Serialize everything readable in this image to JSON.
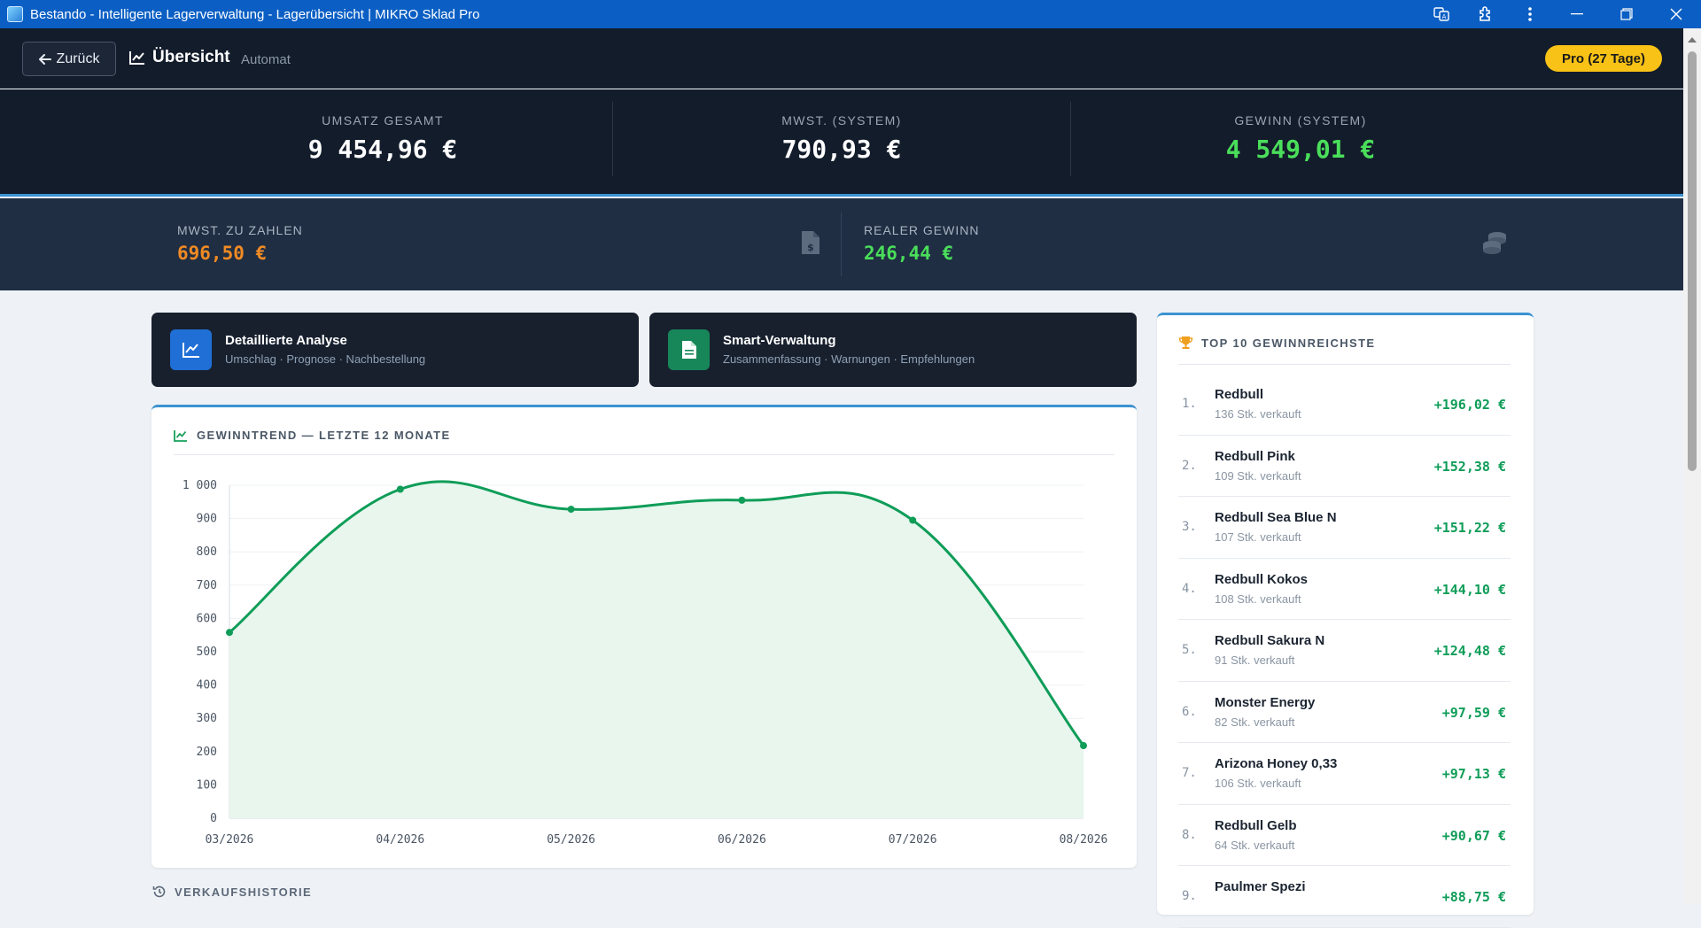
{
  "window": {
    "title": "Bestando - Intelligente Lagerverwaltung - Lagerübersicht | MIKRO Sklad Pro"
  },
  "header": {
    "back_label": "Zurück",
    "title": "Übersicht",
    "subtitle": "Automat",
    "badge": "Pro (27 Tage)"
  },
  "stats": [
    {
      "label": "UMSATZ GESAMT",
      "value": "9 454,96 €",
      "color": "#ffffff"
    },
    {
      "label": "MWST. (SYSTEM)",
      "value": "790,93 €",
      "color": "#ffffff"
    },
    {
      "label": "GEWINN (SYSTEM)",
      "value": "4 549,01 €",
      "color": "#4ade5a"
    }
  ],
  "stats2": [
    {
      "label": "MWST. ZU ZAHLEN",
      "value": "696,50 €",
      "color": "#f08a24",
      "icon": "invoice-dollar-icon"
    },
    {
      "label": "REALER GEWINN",
      "value": "246,44 €",
      "color": "#4ade5a",
      "icon": "coins-icon"
    }
  ],
  "cards": [
    {
      "title": "Detaillierte Analyse",
      "subtitle": "Umschlag · Prognose · Nachbestellung",
      "color": "#1f6fd6"
    },
    {
      "title": "Smart-Verwaltung",
      "subtitle": "Zusammenfassung · Warnungen · Empfehlungen",
      "color": "#17875a"
    }
  ],
  "chart_title": "GEWINNTREND — LETZTE 12 MONATE",
  "history_title": "VERKAUFSHISTORIE",
  "chart_data": {
    "type": "area",
    "categories": [
      "03/2026",
      "04/2026",
      "05/2026",
      "06/2026",
      "07/2026",
      "08/2026"
    ],
    "series": [
      {
        "values": [
          558,
          988,
          928,
          955,
          895,
          218
        ]
      }
    ],
    "ylim": [
      0,
      1000
    ],
    "yticks": [
      "0",
      "100",
      "200",
      "300",
      "400",
      "500",
      "600",
      "700",
      "800",
      "900",
      "1 000"
    ],
    "grid": true,
    "line_color": "#0f9d58",
    "fill_color": "#e8f6ee"
  },
  "top10": {
    "title": "TOP 10 GEWINNREICHSTE",
    "items": [
      {
        "rank": "1.",
        "name": "Redbull",
        "sold": "136 Stk. verkauft",
        "profit": "+196,02 €"
      },
      {
        "rank": "2.",
        "name": "Redbull Pink",
        "sold": "109 Stk. verkauft",
        "profit": "+152,38 €"
      },
      {
        "rank": "3.",
        "name": "Redbull Sea Blue N",
        "sold": "107 Stk. verkauft",
        "profit": "+151,22 €"
      },
      {
        "rank": "4.",
        "name": "Redbull Kokos",
        "sold": "108 Stk. verkauft",
        "profit": "+144,10 €"
      },
      {
        "rank": "5.",
        "name": "Redbull Sakura N",
        "sold": "91 Stk. verkauft",
        "profit": "+124,48 €"
      },
      {
        "rank": "6.",
        "name": "Monster Energy",
        "sold": "82 Stk. verkauft",
        "profit": "+97,59 €"
      },
      {
        "rank": "7.",
        "name": "Arizona Honey 0,33",
        "sold": "106 Stk. verkauft",
        "profit": "+97,13 €"
      },
      {
        "rank": "8.",
        "name": "Redbull Gelb",
        "sold": "64 Stk. verkauft",
        "profit": "+90,67 €"
      },
      {
        "rank": "9.",
        "name": "Paulmer Spezi",
        "sold": "",
        "profit": "+88,75 €"
      }
    ]
  }
}
